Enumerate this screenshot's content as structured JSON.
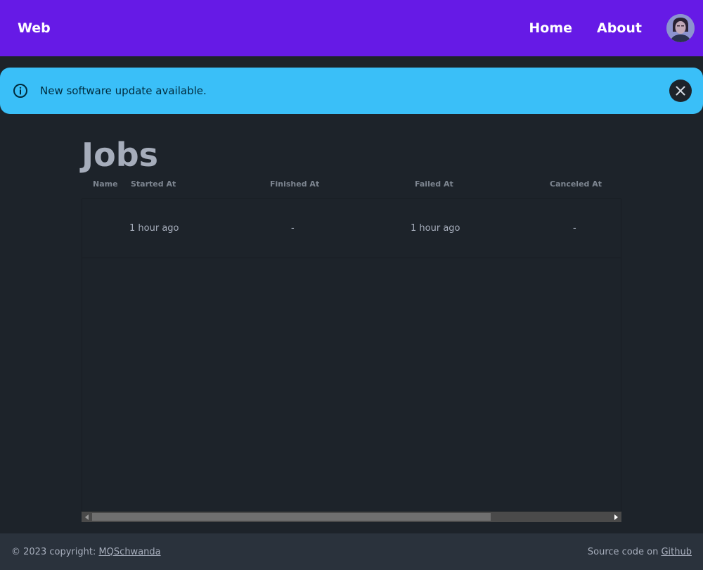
{
  "navbar": {
    "brand": "Web",
    "links": [
      "Home",
      "About"
    ],
    "accent_color": "#661ae6"
  },
  "alert": {
    "message": "New software update available.",
    "icon": "info-icon",
    "close_icon": "close-icon",
    "color": "#3abff8"
  },
  "page": {
    "title": "Jobs"
  },
  "table": {
    "columns": [
      "Name",
      "Started At",
      "Finished At",
      "Failed At",
      "Canceled At"
    ],
    "rows": [
      {
        "name": "",
        "started_at": "1 hour ago",
        "finished_at": "-",
        "failed_at": "1 hour ago",
        "canceled_at": "-"
      }
    ]
  },
  "footer": {
    "copyright_prefix": "© 2023 copyright:",
    "author": "MQSchwanda",
    "source_prefix": "Source code on",
    "source_link": "Github"
  }
}
